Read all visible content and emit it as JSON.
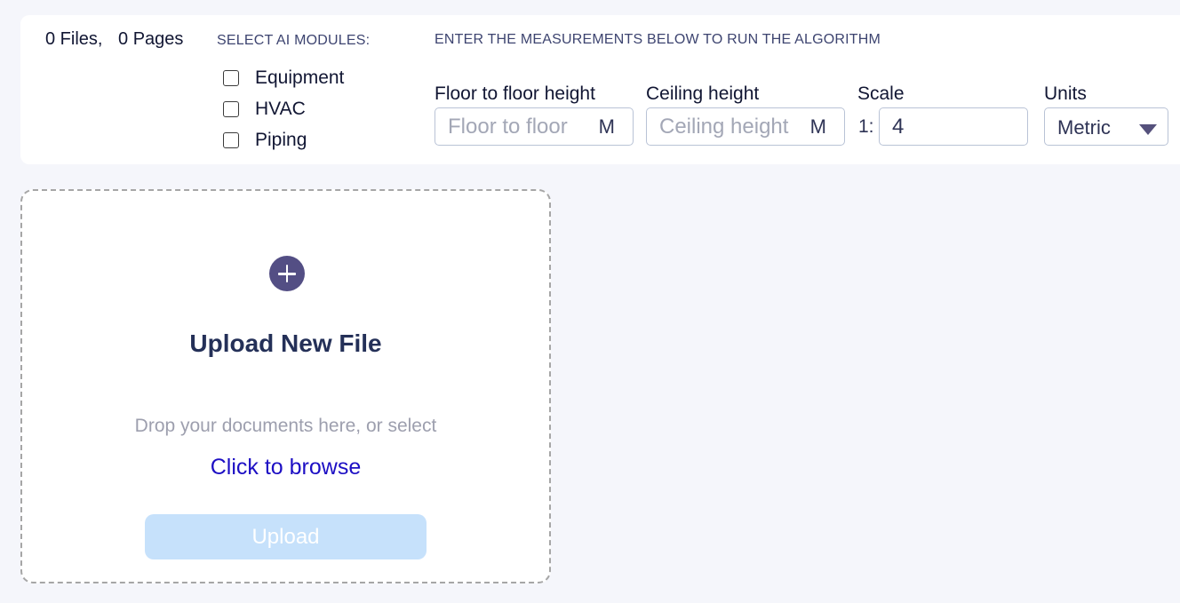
{
  "summary": {
    "files": "0 Files,",
    "pages": "0 Pages"
  },
  "modules": {
    "title": "SELECT AI MODULES:",
    "items": [
      {
        "label": "Equipment",
        "checked": false
      },
      {
        "label": "HVAC",
        "checked": false
      },
      {
        "label": "Piping",
        "checked": false
      }
    ]
  },
  "measurements": {
    "title": "ENTER THE MEASUREMENTS BELOW TO RUN THE ALGORITHM",
    "floor_to_floor": {
      "label": "Floor to floor height",
      "placeholder": "Floor to floor",
      "value": "",
      "unit": "M"
    },
    "ceiling": {
      "label": "Ceiling height",
      "placeholder": "Ceiling height",
      "value": "",
      "unit": "M"
    },
    "scale": {
      "label": "Scale",
      "prefix": "1:",
      "value": "4"
    },
    "units": {
      "label": "Units",
      "selected": "Metric"
    }
  },
  "upload": {
    "title": "Upload New File",
    "drop_text": "Drop your documents here, or select",
    "browse_label": "Click to browse",
    "button_label": "Upload"
  },
  "colors": {
    "accent": "#534e84",
    "link": "#1d0fc4",
    "upload_button_disabled": "#c6e1fb",
    "page_background": "#f5f6fb"
  },
  "icons": {
    "add": "plus-circle-icon",
    "dropdown": "caret-down-icon"
  }
}
